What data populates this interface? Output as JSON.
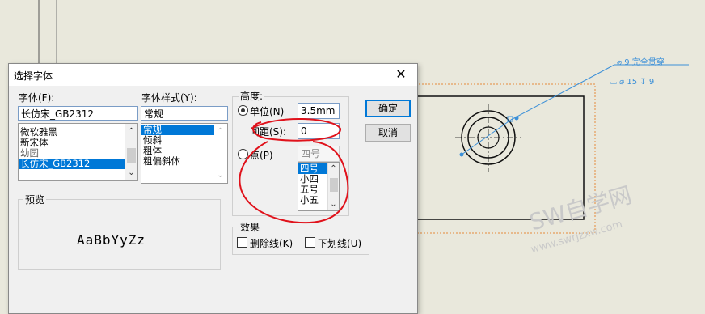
{
  "dialog": {
    "title": "选择字体",
    "close_glyph": "✕",
    "font_label": "字体(F):",
    "font_value": "长仿宋_GB2312",
    "font_list": [
      "微软雅黑",
      "新宋体",
      "幼圆",
      "长仿宋_GB2312"
    ],
    "font_selected_index": 3,
    "style_label": "字体样式(Y):",
    "style_value": "常规",
    "style_list": [
      "常规",
      "倾斜",
      "粗体",
      "粗偏斜体"
    ],
    "style_selected_index": 0,
    "preview_label": "预览",
    "preview_text": "AaBbYyZz",
    "height_label": "高度:",
    "unit_label": "单位(N)",
    "unit_value": "3.5mm",
    "spacing_label": "间距(S):",
    "spacing_value": "0",
    "point_label": "点(P)",
    "point_value": "四号",
    "point_list": [
      "四号",
      "小四",
      "五号",
      "小五"
    ],
    "point_selected_index": 0,
    "effects_label": "效果",
    "strikeout_label": "删除线(K)",
    "underline_label": "下划线(U)",
    "ok_label": "确定",
    "cancel_label": "取消"
  },
  "cad": {
    "note_line1": "⌀ 9 完全贯穿",
    "note_line2": "⌴ ⌀ 15 ↧ 9"
  },
  "watermark": {
    "text": "SW自学网",
    "url": "www.swrjzxw.com"
  },
  "colors": {
    "accent": "#0078d7",
    "annotation_red": "#e0121b",
    "cad_blue": "#3a8fd8",
    "cad_orange": "#e58a3a"
  }
}
